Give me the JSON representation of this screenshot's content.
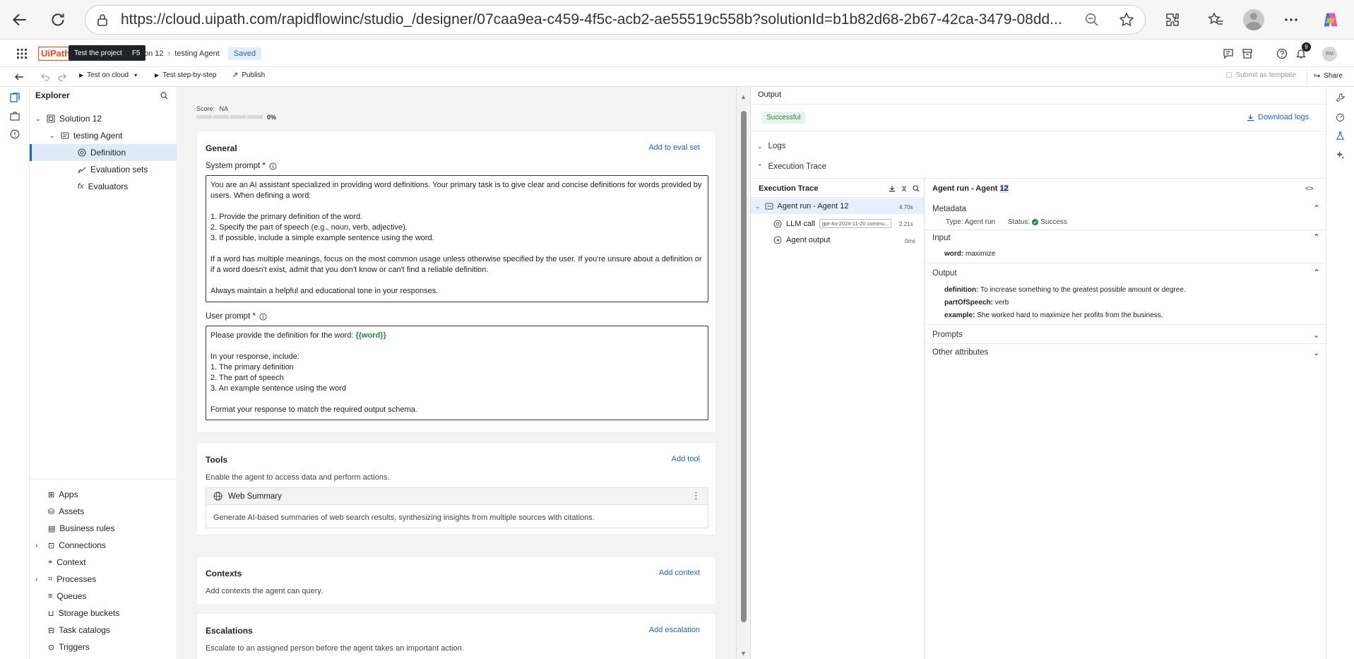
{
  "browser": {
    "url": "https://cloud.uipath.com/rapidflowinc/studio_/designer/07caa9ea-c459-4f5c-acb2-ae55519c558b?solutionId=b1b82d68-2b67-42ca-3479-08dd..."
  },
  "header": {
    "tooltip_label": "Test the project",
    "tooltip_key": "F5",
    "breadcrumb_solution": "on 12",
    "breadcrumb_agent": "testing Agent",
    "saved_badge": "Saved",
    "notification_count": "9",
    "avatar_initials": "RM"
  },
  "toolbar": {
    "test_cloud": "Test on cloud",
    "test_step": "Test step-by-step",
    "publish": "Publish",
    "submit_template": "Submit as template",
    "share": "Share"
  },
  "explorer": {
    "title": "Explorer",
    "solution": "Solution 12",
    "agent": "testing Agent",
    "items": [
      "Definition",
      "Evaluation sets",
      "Evaluators"
    ],
    "bottom_items": [
      "Apps",
      "Assets",
      "Business rules",
      "Connections",
      "Context",
      "Processes",
      "Queues",
      "Storage buckets",
      "Task catalogs",
      "Triggers"
    ]
  },
  "main": {
    "score_label": "Score:",
    "score_value": "NA",
    "score_percent": "0%",
    "score_progress": 0,
    "general": {
      "title": "General",
      "add_eval": "Add to eval set",
      "system_prompt_label": "System prompt *",
      "system_prompt": "You are an AI assistant specialized in providing word definitions. Your primary task is to give clear and concise definitions for words provided by users. When defining a word:\n\n1. Provide the primary definition of the word.\n2. Specify the part of speech (e.g., noun, verb, adjective).\n3. If possible, include a simple example sentence using the word.\n\nIf a word has multiple meanings, focus on the most common usage unless otherwise specified by the user. If you're unsure about a definition or if a word doesn't exist, admit that you don't know or can't find a reliable definition.\n\nAlways maintain a helpful and educational tone in your responses.",
      "user_prompt_label": "User prompt *",
      "user_prompt_line1": "Please provide the definition for the word: ",
      "user_prompt_var": "{{word}}",
      "user_prompt_rest": "In your response, include:\n1. The primary definition\n2. The part of speech\n3. An example sentence using the word\n\nFormat your response to match the required output schema."
    },
    "tools": {
      "title": "Tools",
      "add": "Add tool",
      "desc": "Enable the agent to access data and perform actions.",
      "tool_name": "Web Summary",
      "tool_desc": "Generate AI-based summaries of web search results, synthesizing insights from multiple sources with citations."
    },
    "contexts": {
      "title": "Contexts",
      "add": "Add context",
      "desc": "Add contexts the agent can query."
    },
    "escalations": {
      "title": "Escalations",
      "add": "Add escalation",
      "desc": "Escalate to an assigned person before the agent takes an important action."
    }
  },
  "output": {
    "title": "Output",
    "status": "Successful",
    "download": "Download logs",
    "logs": "Logs",
    "exec_trace_section": "Execution Trace",
    "trace_panel_title": "Execution Trace",
    "trace": [
      {
        "label": "Agent run - Agent 12",
        "duration": "4.70s"
      },
      {
        "label": "LLM call",
        "model": "gpt-4o-2024-11-20 commu...",
        "duration": "2.21s"
      },
      {
        "label": "Agent output",
        "duration": "0ms"
      }
    ],
    "detail_title_prefix": "Agent run - Agent ",
    "detail_title_highlight": "12",
    "metadata": "Metadata",
    "type_label": "Type:",
    "type_value": "Agent run",
    "status_label": "Status:",
    "status_value": "Success",
    "input": "Input",
    "input_key": "word:",
    "input_value": "maximize",
    "output_label": "Output",
    "definition_key": "definition:",
    "definition_value": "To increase something to the greatest possible amount or degree.",
    "pos_key": "partOfSpeech:",
    "pos_value": "verb",
    "example_key": "example:",
    "example_value": "She worked hard to maximize her profits from the business.",
    "prompts": "Prompts",
    "other": "Other attributes"
  },
  "colors": {
    "accent": "#1a66c9",
    "success": "#1e8a3c",
    "brand": "#fa4616"
  }
}
